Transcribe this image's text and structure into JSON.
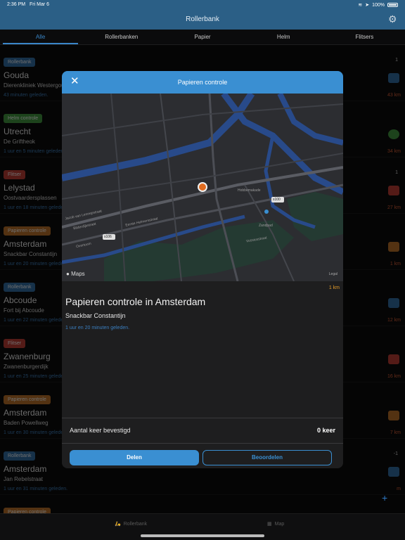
{
  "status": {
    "time": "2:36 PM",
    "date": "Fri Mar 6",
    "battery": "100%"
  },
  "nav": {
    "title": "Rollerbank"
  },
  "tabs": [
    "Alle",
    "Rollerbanken",
    "Papier",
    "Helm",
    "Flitsers"
  ],
  "rows": [
    {
      "badge": "Rollerbank",
      "badge_color": "#2f6ea8",
      "city": "Gouda",
      "street": "Dierenkliniek Westergouwe",
      "ago": "43 minuten geleden.",
      "count": "1",
      "distance": "43 km",
      "icon": "scooter-icon",
      "icon_color": "#2f6ea8"
    },
    {
      "badge": "Helm controle",
      "badge_color": "#3f9a3d",
      "city": "Utrecht",
      "street": "De Griftheok",
      "ago": "1 uur en 5 minuten geleden.",
      "count": "",
      "distance": "34 km",
      "icon": "helmet-icon",
      "icon_color": "#3f9a3d"
    },
    {
      "badge": "Flitser",
      "badge_color": "#c23b32",
      "city": "Lelystad",
      "street": "Oostvaardersplassen",
      "ago": "1 uur en 18 minuten geleden.",
      "count": "1",
      "distance": "27 km",
      "icon": "speed-camera-icon",
      "icon_color": "#c23b32"
    },
    {
      "badge": "Papieren controle",
      "badge_color": "#c07226",
      "city": "Amsterdam",
      "street": "Snackbar Constantijn",
      "ago": "1 uur en 20 minuten geleden.",
      "count": "",
      "distance": "1 km",
      "icon": "id-card-icon",
      "icon_color": "#c07226"
    },
    {
      "badge": "Rollerbank",
      "badge_color": "#2f6ea8",
      "city": "Abcoude",
      "street": "Fort bij Abcoude",
      "ago": "1 uur en 22 minuten geleden.",
      "count": "",
      "distance": "12 km",
      "icon": "scooter-icon",
      "icon_color": "#2f6ea8"
    },
    {
      "badge": "Flitser",
      "badge_color": "#c23b32",
      "city": "Zwanenburg",
      "street": "Zwanenburgerdijk",
      "ago": "1 uur en 25 minuten geleden.",
      "count": "",
      "distance": "16 km",
      "icon": "speed-camera-icon",
      "icon_color": "#c23b32"
    },
    {
      "badge": "Papieren controle",
      "badge_color": "#c07226",
      "city": "Amsterdam",
      "street": "Baden Powellweg",
      "ago": "1 uur en 30 minuten geleden.",
      "count": "",
      "distance": "7 km",
      "icon": "id-card-icon",
      "icon_color": "#c07226"
    },
    {
      "badge": "Rollerbank",
      "badge_color": "#2f6ea8",
      "city": "Amsterdam",
      "street": "Jan Rebelstraat",
      "ago": "1 uur en 31 minuten geleden.",
      "count": "-1",
      "distance": "m",
      "icon": "scooter-icon",
      "icon_color": "#2f6ea8"
    },
    {
      "badge": "Papieren controle",
      "badge_color": "#c07226",
      "city": "",
      "street": "",
      "ago": "",
      "count": "",
      "distance": "",
      "icon": "id-card-icon",
      "icon_color": "#c07226"
    }
  ],
  "bottom_tabs": {
    "rollerbank": "Rollerbank",
    "map": "Map"
  },
  "modal": {
    "title": "Papieren controle",
    "distance": "1 km",
    "heading": "Papieren controle in Amsterdam",
    "street": "Snackbar Constantijn",
    "ago": "1 uur en 20 minuten geleden.",
    "confirm_label": "Aantal keer bevestigd",
    "confirm_value": "0 keer",
    "share_label": "Delen",
    "rate_label": "Beoordelen",
    "map_brand": "Maps",
    "map_legal": "Legal",
    "map_labels": {
      "e106": "s106",
      "e100": "s100",
      "street1": "Eerste Helmersstraat",
      "street2": "Zandpad",
      "street3": "Vossiusstraat",
      "street4": "Overtoom",
      "street5": "Bilderdijkstraat",
      "street6": "Jacob van Lennepstraat",
      "street7": "Hobbemakade"
    }
  }
}
